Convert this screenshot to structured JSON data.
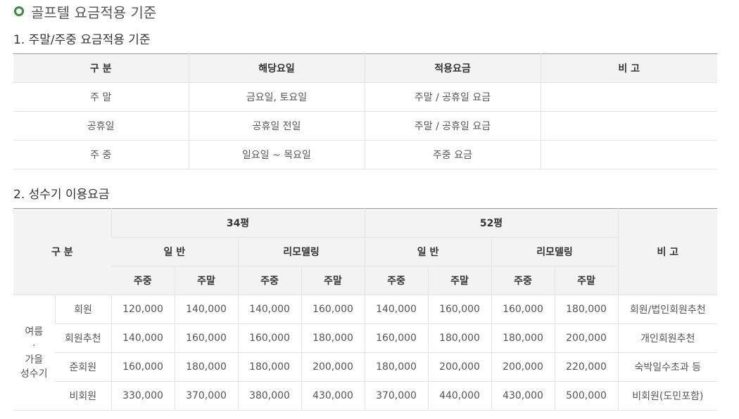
{
  "page_title": "골프텔 요금적용 기준",
  "section1": {
    "title": "1. 주말/주중 요금적용 기준",
    "headers": [
      "구 분",
      "해당요일",
      "적용요금",
      "비 고"
    ],
    "rows": [
      [
        "주 말",
        "금요일, 토요일",
        "주말 / 공휴일 요금",
        ""
      ],
      [
        "공휴일",
        "공휴일 전일",
        "주말 / 공휴일 요금",
        ""
      ],
      [
        "주 중",
        "일요일 ~ 목요일",
        "주중 요금",
        ""
      ]
    ]
  },
  "section2": {
    "title": "2. 성수기 이용요금",
    "header": {
      "category": "구 분",
      "size_34": "34평",
      "size_52": "52평",
      "general": "일 반",
      "remodel": "리모델링",
      "weekday": "주중",
      "weekend": "주말",
      "remarks": "비 고"
    },
    "season_label_1": "여름",
    "season_label_2": "·",
    "season_label_3": "가을",
    "season_label_4": "성수기",
    "rows": [
      {
        "type": "회원",
        "prices": [
          "120,000",
          "140,000",
          "140,000",
          "160,000",
          "140,000",
          "160,000",
          "160,000",
          "180,000"
        ],
        "note": "회원/법인회원추천"
      },
      {
        "type": "회원추천",
        "prices": [
          "140,000",
          "160,000",
          "160,000",
          "180,000",
          "160,000",
          "180,000",
          "180,000",
          "200,000"
        ],
        "note": "개인회원추천"
      },
      {
        "type": "준회원",
        "prices": [
          "160,000",
          "180,000",
          "180,000",
          "200,000",
          "180,000",
          "200,000",
          "200,000",
          "220,000"
        ],
        "note": "숙박일수초과 등"
      },
      {
        "type": "비회원",
        "prices": [
          "330,000",
          "370,000",
          "380,000",
          "430,000",
          "370,000",
          "440,000",
          "430,000",
          "500,000"
        ],
        "note": "비회원(도민포함)"
      }
    ]
  },
  "colors": {
    "accent": "#3b8a3e",
    "header_bg": "#f3f3f3",
    "border": "#e3e3e3"
  }
}
